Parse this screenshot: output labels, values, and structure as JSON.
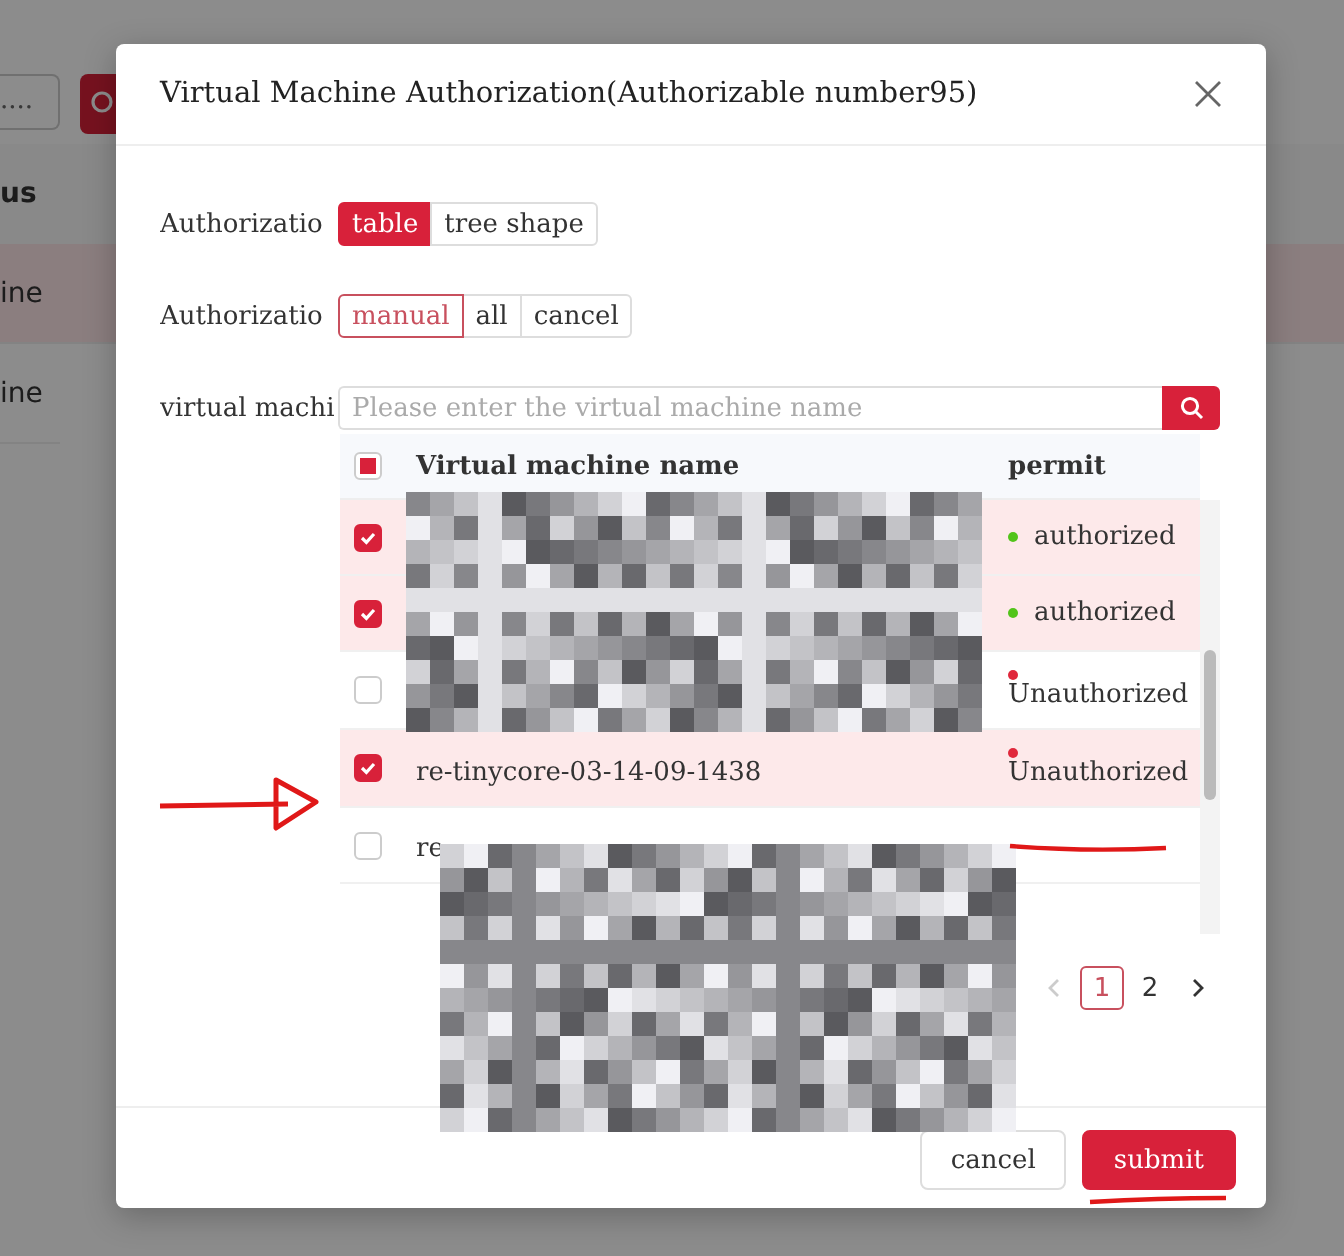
{
  "background": {
    "search_value": "....",
    "column_header": "us",
    "rows": [
      {
        "text": "ine",
        "selected": true
      },
      {
        "text": "ine",
        "selected": false
      }
    ]
  },
  "dialog": {
    "title": "Virtual Machine Authorization(Authorizable number95)",
    "form": [
      {
        "label": "Authorizatio",
        "kind": "segmented",
        "options": [
          {
            "label": "table",
            "selected": true
          },
          {
            "label": "tree shape",
            "selected": false
          }
        ]
      },
      {
        "label": "Authorizatio",
        "kind": "radio",
        "options": [
          {
            "label": "manual",
            "selected": true
          },
          {
            "label": "all",
            "selected": false
          },
          {
            "label": "cancel",
            "selected": false
          }
        ]
      },
      {
        "label": "virtual machi",
        "kind": "search",
        "placeholder": "Please enter the virtual machine name"
      }
    ],
    "table": {
      "header_indeterminate": true,
      "columns": [
        "Virtual machine name",
        "permit"
      ],
      "rows": [
        {
          "checked": true,
          "status": "authorized",
          "color": "#52c41a"
        },
        {
          "checked": true,
          "status": "authorized",
          "color": "#52c41a"
        },
        {
          "checked": false,
          "status": "Unauthorized",
          "color": "#e0283c"
        },
        {
          "checked": true,
          "name": "re-tinycore-03-14-09-1438",
          "status": "Unauthorized",
          "color": "#e0283c"
        },
        {
          "checked": false,
          "name": "re"
        }
      ]
    },
    "pagination": {
      "prev_disabled": true,
      "next_disabled": false,
      "pages": [
        {
          "label": "1",
          "selected": true
        },
        {
          "label": "2",
          "selected": false
        }
      ]
    },
    "buttons": [
      {
        "label": "cancel",
        "kind": "default"
      },
      {
        "label": "submit",
        "kind": "primary"
      }
    ]
  }
}
